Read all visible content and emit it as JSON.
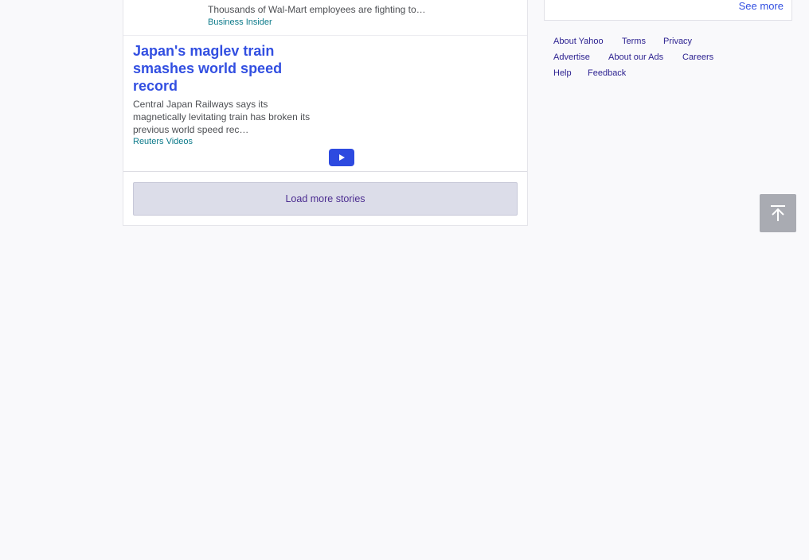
{
  "stories": [
    {
      "title": "…",
      "summary": "Thousands of Wal-Mart employees are fighting to…",
      "source": "Business Insider"
    },
    {
      "title": "Japan's maglev train smashes world speed record",
      "summary": "Central Japan Railways says its magnetically levitating train has broken its previous world speed rec…",
      "source": "Reuters Videos",
      "media_icon": "play-icon"
    }
  ],
  "load_more_label": "Load more stories",
  "sidebar": {
    "see_more_label": "See more"
  },
  "footer": {
    "links": [
      "About Yahoo",
      "Terms",
      "Privacy",
      "Advertise",
      "About our Ads",
      "Careers",
      "Help",
      "Feedback"
    ]
  },
  "back_to_top_icon": "arrow-up-to-line-icon",
  "colors": {
    "link_blue": "#324fe1",
    "source_teal": "#0c7a8a",
    "button_bg": "#dcdde9",
    "button_text": "#4b2c90",
    "play_button": "#2d4ae0"
  }
}
